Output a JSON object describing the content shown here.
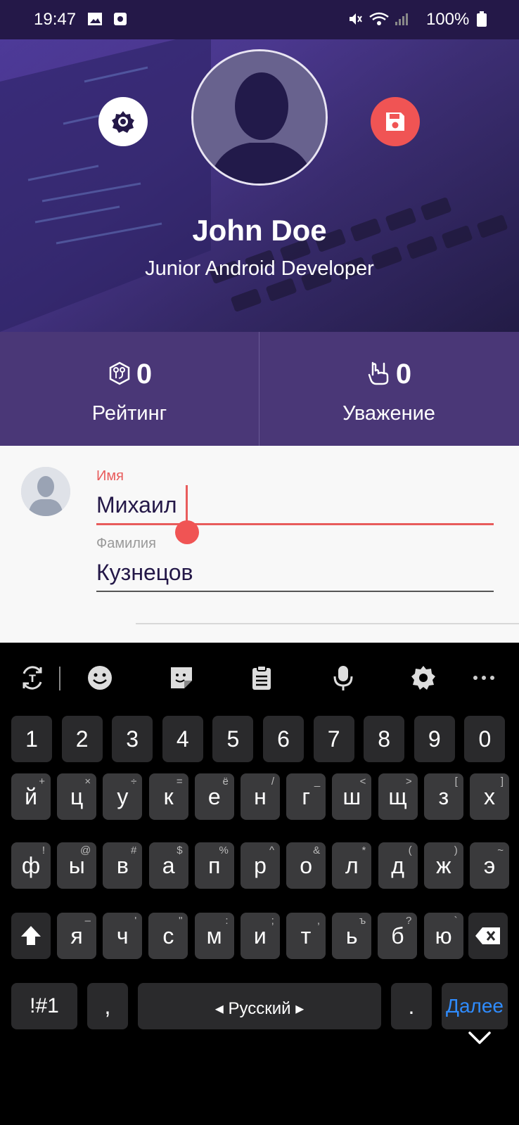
{
  "status_bar": {
    "time": "19:47",
    "battery": "100%",
    "icons": [
      "gallery-icon",
      "screen-record-icon",
      "mute-icon",
      "wifi-icon",
      "signal-icon",
      "battery-icon"
    ]
  },
  "header": {
    "name": "John Doe",
    "title": "Junior Android Developer",
    "settings_icon": "gear-icon",
    "save_icon": "save-icon"
  },
  "stats": {
    "rating": {
      "value": "0",
      "label": "Рейтинг",
      "icon": "rating-badge-icon"
    },
    "respect": {
      "value": "0",
      "label": "Уважение",
      "icon": "rock-hand-icon"
    }
  },
  "form": {
    "first_name_label": "Имя",
    "first_name_value": "Михаил",
    "last_name_label": "Фамилия",
    "last_name_value": "Кузнецов"
  },
  "keyboard": {
    "toolbar": [
      "translate-icon",
      "emoji-icon",
      "sticker-icon",
      "clipboard-icon",
      "mic-icon",
      "gear-icon",
      "more-icon"
    ],
    "numbers": [
      "1",
      "2",
      "3",
      "4",
      "5",
      "6",
      "7",
      "8",
      "9",
      "0"
    ],
    "row1": [
      "й",
      "ц",
      "у",
      "к",
      "е",
      "н",
      "г",
      "ш",
      "щ",
      "з",
      "х"
    ],
    "row1_sub": [
      "+",
      "×",
      "÷",
      "=",
      "ё",
      "/",
      "_",
      "<",
      ">",
      "[",
      "]"
    ],
    "row2": [
      "ф",
      "ы",
      "в",
      "а",
      "п",
      "р",
      "о",
      "л",
      "д",
      "ж",
      "э"
    ],
    "row2_sub": [
      "!",
      "@",
      "#",
      "$",
      "%",
      "^",
      "&",
      "*",
      "(",
      ")",
      "~"
    ],
    "row3": [
      "я",
      "ч",
      "с",
      "м",
      "и",
      "т",
      "ь",
      "б",
      "ю"
    ],
    "row3_sub": [
      "–",
      "'",
      "\"",
      ":",
      ";",
      ",",
      "ъ",
      "?",
      "`"
    ],
    "symbols": "!#1",
    "comma": ",",
    "space": "Русский",
    "period": ".",
    "go": "Далее"
  },
  "colors": {
    "accent": "#f05454",
    "stats_bg": "#4a3777",
    "status_bg": "#241848",
    "go_key": "#2f8cff"
  }
}
